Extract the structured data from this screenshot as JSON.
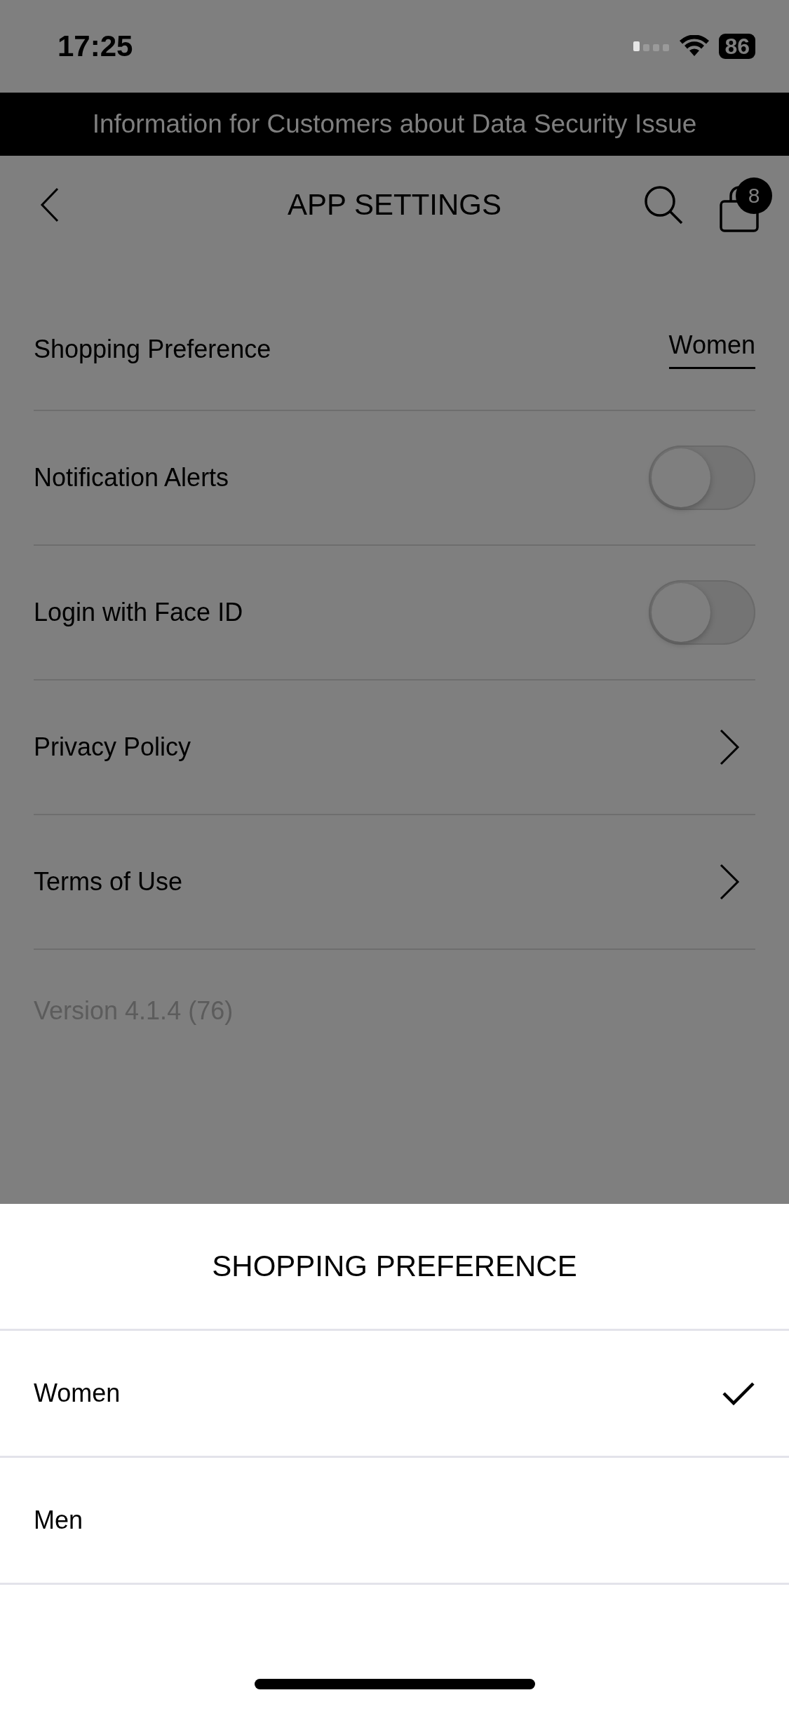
{
  "status_bar": {
    "time": "17:25",
    "battery": "86"
  },
  "banner": {
    "text": "Information for Customers about Data Security Issue"
  },
  "header": {
    "title": "APP SETTINGS",
    "cart_count": "8"
  },
  "settings": [
    {
      "kind": "value",
      "label": "Shopping Preference",
      "value": "Women"
    },
    {
      "kind": "toggle",
      "label": "Notification Alerts",
      "on": false
    },
    {
      "kind": "toggle",
      "label": "Login with Face ID",
      "on": false
    },
    {
      "kind": "link",
      "label": "Privacy Policy"
    },
    {
      "kind": "link",
      "label": "Terms of Use"
    }
  ],
  "version": "Version 4.1.4 (76)",
  "sheet": {
    "title": "SHOPPING PREFERENCE",
    "options": [
      {
        "label": "Women",
        "selected": true
      },
      {
        "label": "Men",
        "selected": false
      }
    ]
  }
}
